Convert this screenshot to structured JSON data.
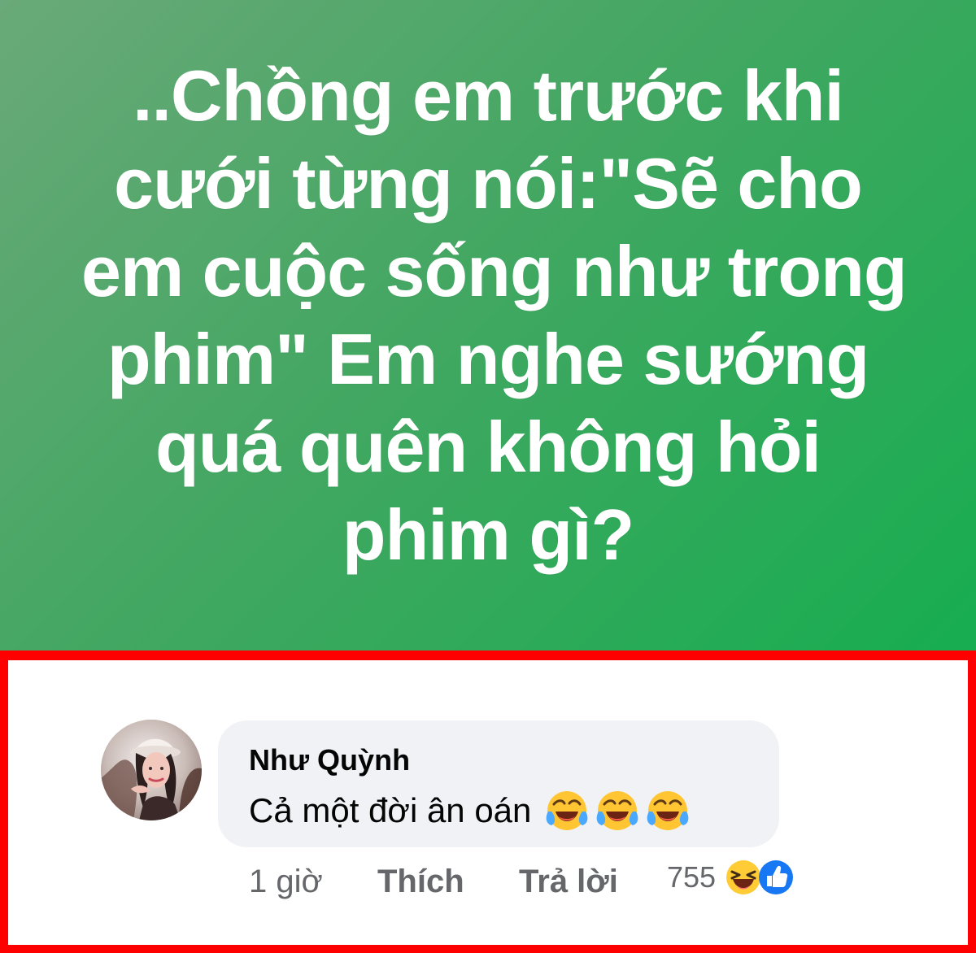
{
  "post": {
    "text_lines": [
      "..Chồng em trước khi",
      "cưới từng nói:\"Sẽ cho",
      "em cuộc sống như trong",
      "phim\" Em nghe sướng",
      "quá quên không hỏi",
      "phim gì?"
    ],
    "background_start_color": "#6aa979",
    "background_end_color": "#17ad50"
  },
  "highlight_frame": {
    "border_color": "#ff0000"
  },
  "comment": {
    "author": "Như Quỳnh",
    "text": "Cả một đời ân oán",
    "emojis": [
      "tears-of-joy-icon",
      "tears-of-joy-icon",
      "tears-of-joy-icon"
    ],
    "time": "1 giờ",
    "like_label": "Thích",
    "reply_label": "Trả lời",
    "reaction_count": "755",
    "reaction_icons": [
      "haha-reaction-icon",
      "like-reaction-icon"
    ]
  }
}
